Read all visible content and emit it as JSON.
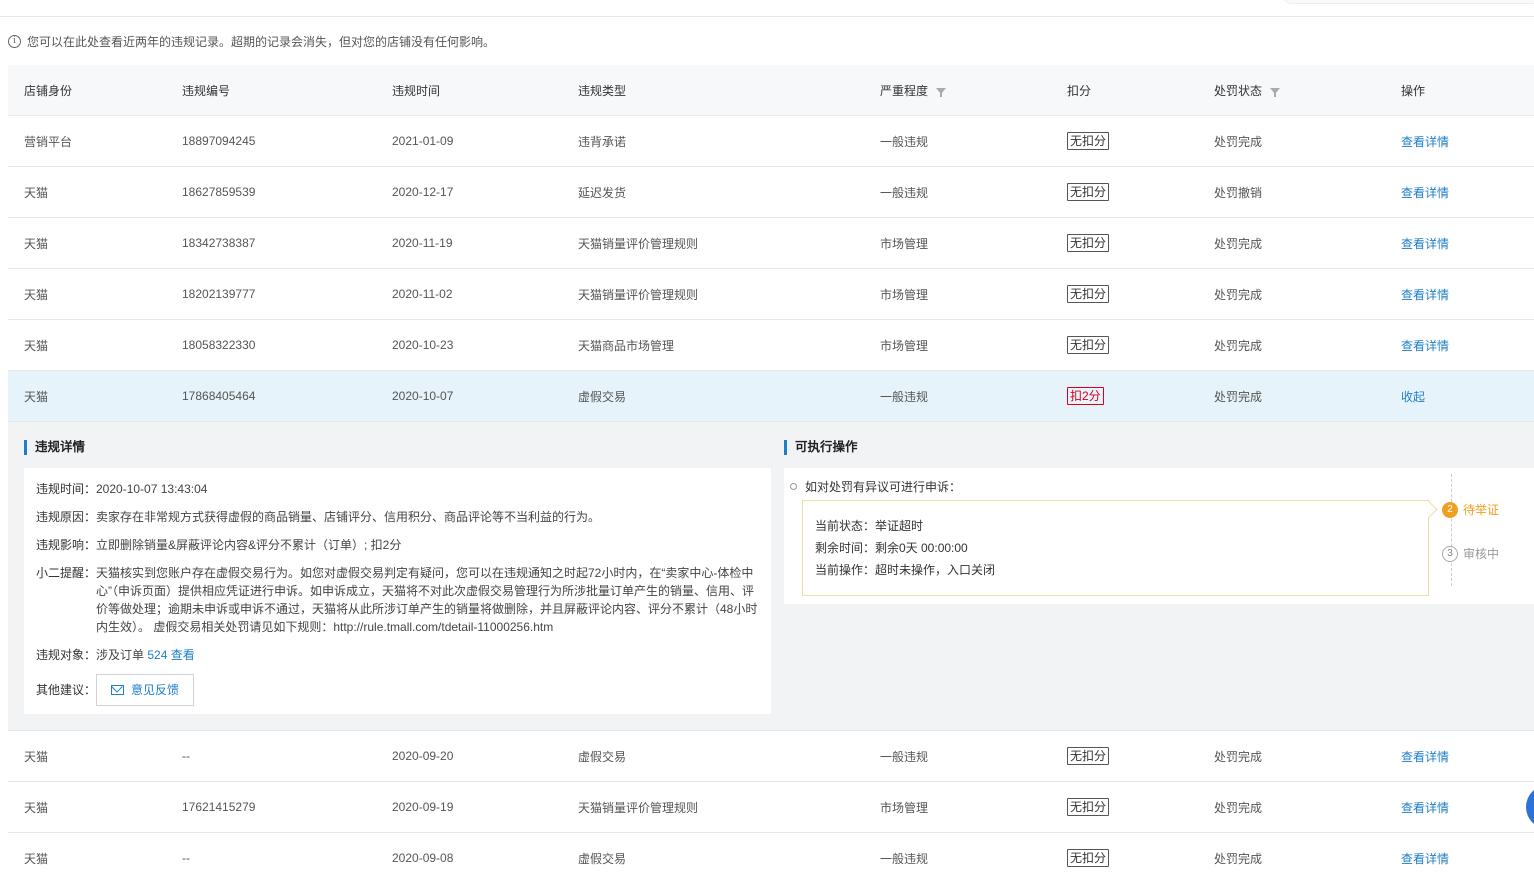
{
  "notice": "您可以在此处查看近两年的违规记录。超期的记录会消失，但对您的店铺没有任何影响。",
  "columns": {
    "shop": "店铺身份",
    "id": "违规编号",
    "time": "违规时间",
    "type": "违规类型",
    "severity": "严重程度",
    "points": "扣分",
    "status": "处罚状态",
    "action": "操作"
  },
  "rows": [
    {
      "shop": "营销平台",
      "id": "18897094245",
      "time": "2021-01-09",
      "type": "违背承诺",
      "severity": "一般违规",
      "points": "无扣分",
      "status": "处罚完成",
      "action": "查看详情"
    },
    {
      "shop": "天猫",
      "id": "18627859539",
      "time": "2020-12-17",
      "type": "延迟发货",
      "severity": "一般违规",
      "points": "无扣分",
      "status": "处罚撤销",
      "action": "查看详情"
    },
    {
      "shop": "天猫",
      "id": "18342738387",
      "time": "2020-11-19",
      "type": "天猫销量评价管理规则",
      "severity": "市场管理",
      "points": "无扣分",
      "status": "处罚完成",
      "action": "查看详情"
    },
    {
      "shop": "天猫",
      "id": "18202139777",
      "time": "2020-11-02",
      "type": "天猫销量评价管理规则",
      "severity": "市场管理",
      "points": "无扣分",
      "status": "处罚完成",
      "action": "查看详情"
    },
    {
      "shop": "天猫",
      "id": "18058322330",
      "time": "2020-10-23",
      "type": "天猫商品市场管理",
      "severity": "市场管理",
      "points": "无扣分",
      "status": "处罚完成",
      "action": "查看详情"
    },
    {
      "shop": "天猫",
      "id": "17868405464",
      "time": "2020-10-07",
      "type": "虚假交易",
      "severity": "一般违规",
      "points": "扣2分",
      "status": "处罚完成",
      "action": "收起"
    },
    {
      "shop": "天猫",
      "id": "--",
      "time": "2020-09-20",
      "type": "虚假交易",
      "severity": "一般违规",
      "points": "无扣分",
      "status": "处罚完成",
      "action": "查看详情"
    },
    {
      "shop": "天猫",
      "id": "17621415279",
      "time": "2020-09-19",
      "type": "天猫销量评价管理规则",
      "severity": "市场管理",
      "points": "无扣分",
      "status": "处罚完成",
      "action": "查看详情"
    },
    {
      "shop": "天猫",
      "id": "--",
      "time": "2020-09-08",
      "type": "虚假交易",
      "severity": "一般违规",
      "points": "无扣分",
      "status": "处罚完成",
      "action": "查看详情"
    }
  ],
  "detail": {
    "title": "违规详情",
    "time_label": "违规时间：",
    "time_value": "2020-10-07 13:43:04",
    "reason_label": "违规原因：",
    "reason_value": "卖家存在非常规方式获得虚假的商品销量、店铺评分、信用积分、商品评论等不当利益的行为。",
    "impact_label": "违规影响：",
    "impact_value": "立即删除销量&屏蔽评论内容&评分不累计（订单）; 扣2分",
    "tip_label": "小二提醒：",
    "tip_value": "天猫核实到您账户存在虚假交易行为。如您对虚假交易判定有疑问，您可以在违规通知之时起72小时内，在“卖家中心-体检中心”（申诉页面）提供相应凭证进行申诉。如申诉成立，天猫将不对此次虚假交易管理行为所涉批量订单产生的销量、信用、评价等做处理；逾期未申诉或申诉不通过，天猫将从此所涉订单产生的销量将做删除，并且屏蔽评论内容、评分不累计（48小时内生效）。 虚假交易相关处罚请见如下规则：http://rule.tmall.com/tdetail-11000256.htm",
    "object_label": "违规对象：",
    "object_prefix": "涉及订单",
    "object_count": "524",
    "object_link": "查看",
    "suggest_label": "其他建议：",
    "feedback": "意见反馈"
  },
  "actions": {
    "title": "可执行操作",
    "appeal": "如对处罚有异议可进行申诉：",
    "state": "当前状态：举证超时",
    "remaining": "剩余时间：剩余0天 00:00:00",
    "operation": "当前操作：超时未操作，入口关闭",
    "step2_num": "2",
    "step2": "待举证",
    "step3_num": "3",
    "step3": "审核中"
  }
}
